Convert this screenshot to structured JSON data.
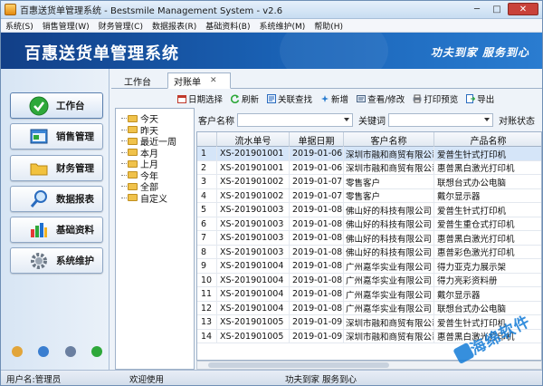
{
  "window": {
    "title": "百惠送货单管理系统 - Bestsmile Management System - v2.6",
    "min_glyph": "─",
    "max_glyph": "□",
    "close_glyph": "✕"
  },
  "menu": [
    "系统(S)",
    "销售管理(W)",
    "财务管理(C)",
    "数据报表(R)",
    "基础资料(B)",
    "系统维护(M)",
    "帮助(H)"
  ],
  "banner": {
    "title": "百惠送货单管理系统",
    "slogan": "功夫到家  服务到心"
  },
  "sidebar": [
    {
      "label": "工作台",
      "icon": "check-icon"
    },
    {
      "label": "销售管理",
      "icon": "sales-window-icon"
    },
    {
      "label": "财务管理",
      "icon": "folder-icon"
    },
    {
      "label": "数据报表",
      "icon": "magnifier-icon"
    },
    {
      "label": "基础资料",
      "icon": "chart-icon"
    },
    {
      "label": "系统维护",
      "icon": "gear-icon"
    }
  ],
  "tabs": {
    "tab1": "工作台",
    "tab2": "对账单",
    "close": "✕"
  },
  "toolbar": [
    "日期选择",
    "刷新",
    "关联查找",
    "新增",
    "查看/修改",
    "打印预览",
    "导出"
  ],
  "tree": [
    "今天",
    "昨天",
    "最近一周",
    "本月",
    "上月",
    "今年",
    "全部",
    "自定义"
  ],
  "filter": {
    "customer_label": "客户名称",
    "keyword_label": "关键词",
    "status_label": "对账状态"
  },
  "grid": {
    "columns": [
      "",
      "流水单号",
      "单据日期",
      "客户名称",
      "产品名称"
    ],
    "rows": [
      [
        "1",
        "XS-201901001",
        "2019-01-06",
        "深圳市融和商贸有限公司",
        "爱普生针式打印机"
      ],
      [
        "2",
        "XS-201901001",
        "2019-01-06",
        "深圳市融和商贸有限公司",
        "惠普黑白激光打印机"
      ],
      [
        "3",
        "XS-201901002",
        "2019-01-07",
        "零售客户",
        "联想台式办公电脑"
      ],
      [
        "4",
        "XS-201901002",
        "2019-01-07",
        "零售客户",
        "戴尔显示器"
      ],
      [
        "5",
        "XS-201901003",
        "2019-01-08",
        "佛山好的科技有限公司",
        "爱普生针式打印机"
      ],
      [
        "6",
        "XS-201901003",
        "2019-01-08",
        "佛山好的科技有限公司",
        "爱普生重仓式打印机"
      ],
      [
        "7",
        "XS-201901003",
        "2019-01-08",
        "佛山好的科技有限公司",
        "惠普黑白激光打印机"
      ],
      [
        "8",
        "XS-201901003",
        "2019-01-08",
        "佛山好的科技有限公司",
        "惠普彩色激光打印机"
      ],
      [
        "9",
        "XS-201901004",
        "2019-01-08",
        "广州嘉华实业有限公司",
        "得力亚克力展示架"
      ],
      [
        "10",
        "XS-201901004",
        "2019-01-08",
        "广州嘉华实业有限公司",
        "得力亮彩资料册"
      ],
      [
        "11",
        "XS-201901004",
        "2019-01-08",
        "广州嘉华实业有限公司",
        "戴尔显示器"
      ],
      [
        "12",
        "XS-201901004",
        "2019-01-08",
        "广州嘉华实业有限公司",
        "联想台式办公电脑"
      ],
      [
        "13",
        "XS-201901005",
        "2019-01-09",
        "深圳市融和商贸有限公司",
        "爱普生针式打印机"
      ],
      [
        "14",
        "XS-201901005",
        "2019-01-09",
        "深圳市融和商贸有限公司",
        "惠普黑白激光打印机"
      ]
    ]
  },
  "status": {
    "user": "用户名:管理员",
    "welcome": "欢迎使用",
    "slogan": "功夫到家 服务到心"
  },
  "watermark": {
    "text": "海绵软件"
  },
  "colors": {
    "banner": "#1a5aa8",
    "accent": "#1a7fd8",
    "selection": "#d5e5f8"
  }
}
